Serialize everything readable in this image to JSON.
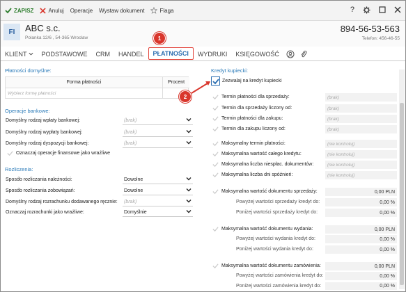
{
  "toolbar": {
    "save": "ZAPISZ",
    "cancel": "Anuluj",
    "operations": "Operacje",
    "issue_document": "Wystaw dokument",
    "flag": "Flaga",
    "help": "?"
  },
  "header": {
    "avatar": "FI",
    "company": "ABC s.c.",
    "address": "Polanka  12/6 , 54-365 Wrocław",
    "phone": "894-56-53-563",
    "phone2": "Telefon: 456-46-55"
  },
  "tabs": [
    "KLIENT",
    "PODSTAWOWE",
    "CRM",
    "HANDEL",
    "PŁATNOŚCI",
    "WYDRUKI",
    "KSIĘGOWOŚĆ"
  ],
  "badges": [
    "1",
    "2"
  ],
  "left": {
    "default_payments": {
      "title": "Płatności domyślne:",
      "col_form": "Forma płatności",
      "col_percent": "Procent",
      "placeholder": "Wybierz formę płatności"
    },
    "bank_ops": {
      "title": "Operacje bankowe:",
      "rows": [
        {
          "label": "Domyślny rodzaj wpłaty bankowej:",
          "value": "(brak)"
        },
        {
          "label": "Domyślny rodzaj wypłaty bankowej:",
          "value": "(brak)"
        },
        {
          "label": "Domyślny rodzaj dyspozycji bankowej:",
          "value": "(brak)"
        }
      ],
      "checkbox": "Oznaczaj operacje finansowe jako wrażliwe"
    },
    "settlement": {
      "title": "Rozliczenia:",
      "rows": [
        {
          "label": "Sposób rozliczania należności:",
          "value": "Dowolne"
        },
        {
          "label": "Sposób rozliczania zobowiązań:",
          "value": "Dowolne"
        },
        {
          "label": "Domyślny rodzaj rozrachunku dodawanego ręcznie:",
          "value": "(brak)"
        },
        {
          "label": "Oznaczaj rozrachunki jako wrażliwe:",
          "value": "Domyślnie"
        }
      ]
    }
  },
  "right": {
    "title": "Kredyt kupiecki:",
    "allow": "Zezwalaj na kredyt kupiecki",
    "terms": [
      {
        "label": "Termin płatności dla sprzedaży:",
        "value": "(brak)"
      },
      {
        "label": "Termin dla sprzedaży liczony od:",
        "value": "(brak)"
      },
      {
        "label": "Termin płatności dla zakupu:",
        "value": "(brak)"
      },
      {
        "label": "Termin dla zakupu liczony od:",
        "value": "(brak)"
      }
    ],
    "limits": [
      {
        "label": "Maksymalny termin płatności:",
        "value": "(nie kontroluj)"
      },
      {
        "label": "Maksymalna wartość całego kredytu:",
        "value": "(nie kontroluj)"
      },
      {
        "label": "Maksymalna liczba niespłac. dokumentów:",
        "value": "(nie kontroluj)"
      },
      {
        "label": "Maksymalna liczba dni spóźnień:",
        "value": "(nie kontroluj)"
      }
    ],
    "groups": [
      {
        "label": "Maksymalna wartość dokumentu sprzedaży:",
        "value": "0,00 PLN",
        "above": "Powyżej wartości sprzedaży kredyt do:",
        "above_value": "0,00 %",
        "below": "Poniżej wartości sprzedaży kredyt do:",
        "below_value": "0,00 %"
      },
      {
        "label": "Maksymalna wartość dokumentu wydania:",
        "value": "0,00 PLN",
        "above": "Powyżej wartości wydania kredyt do:",
        "above_value": "0,00 %",
        "below": "Poniżej wartości wydania kredyt do:",
        "below_value": "0,00 %"
      },
      {
        "label": "Maksymalna wartość dokumentu zamówienia:",
        "value": "0,00 PLN",
        "above": "Powyżej wartości zamówienia kredyt do:",
        "above_value": "0,00 %",
        "below": "Poniżej wartości zamówienia kredyt do:",
        "below_value": "0,00 %"
      }
    ]
  },
  "colors": {
    "accent": "#2a6db0",
    "highlight": "#e2433a",
    "section": "#2a7ab8",
    "save": "#2d7d2d"
  }
}
